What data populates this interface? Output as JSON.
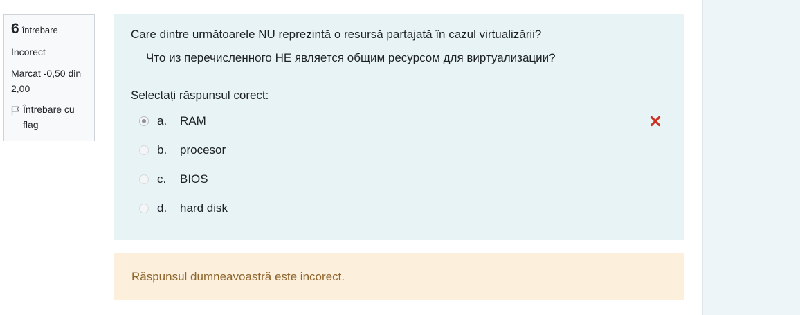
{
  "question_info": {
    "number": "6",
    "number_word": "întrebare",
    "state": "Incorect",
    "grade": "Marcat -0,50 din 2,00",
    "flag_label": "Întrebare cu flag",
    "flag_icon": "flag-icon"
  },
  "question": {
    "text_ro": "Care dintre următoarele NU reprezintă o resursă partajată în cazul virtualizării?",
    "text_ru": "Что из перечисленного НЕ является общим ресурсом для виртуализации?",
    "prompt": "Selectați răspunsul corect:",
    "answers": [
      {
        "letter": "a.",
        "label": "RAM",
        "selected": true,
        "marked_wrong": true
      },
      {
        "letter": "b.",
        "label": "procesor",
        "selected": false
      },
      {
        "letter": "c.",
        "label": "BIOS",
        "selected": false
      },
      {
        "letter": "d.",
        "label": "hard disk",
        "selected": false
      }
    ],
    "wrong_icon": "cross-icon",
    "wrong_color": "#ca3120"
  },
  "feedback": {
    "text": "Răspunsul dumneavoastră este incorect."
  },
  "colors": {
    "question_bg": "#e7f3f5",
    "feedback_bg": "#fcefdc",
    "feedback_text": "#8e662e",
    "sidebar_bg": "#eef5f9"
  }
}
